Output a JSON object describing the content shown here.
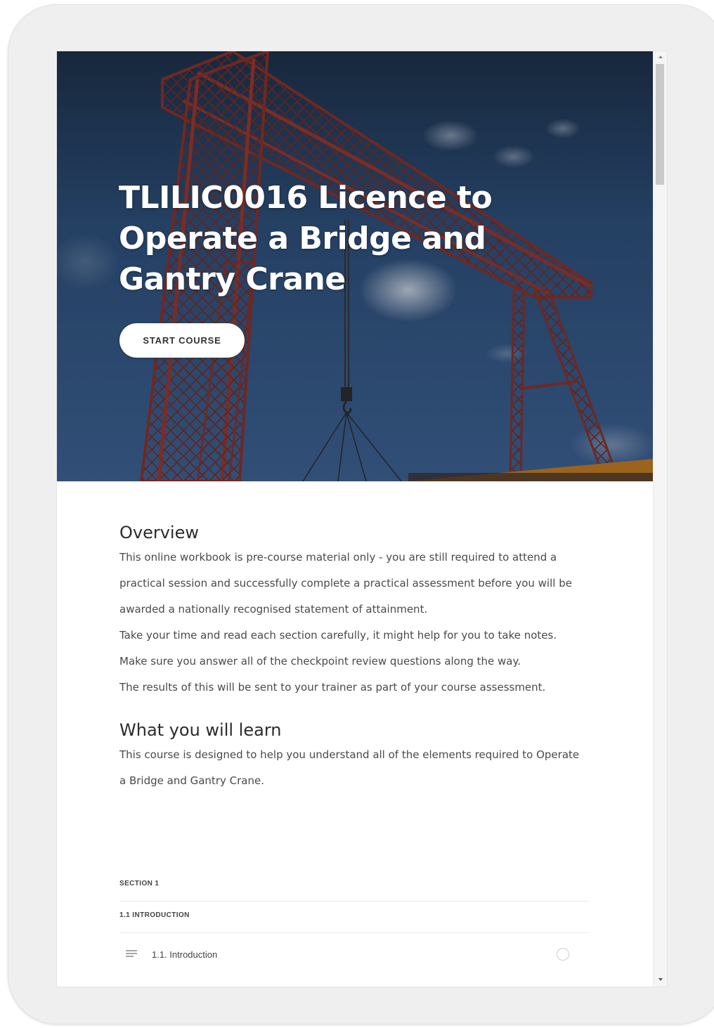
{
  "course": {
    "title": "TLILIC0016 Licence to Operate a Bridge and Gantry Crane",
    "start_button_label": "START COURSE"
  },
  "overview": {
    "heading": "Overview",
    "paragraphs": [
      "This online workbook is pre-course material only - you are still required to attend a practical session and successfully complete a practical assessment before you will be awarded a nationally recognised statement of attainment.",
      "Take your time and read each section carefully, it might help for you to take notes.",
      "Make sure you answer all of the checkpoint review questions along the way.",
      "The results of this will be sent to your trainer as part of your course assessment."
    ]
  },
  "learn": {
    "heading": "What you will learn",
    "paragraph": "This course is designed to help you understand all of the elements required to Operate a Bridge and Gantry Crane."
  },
  "outline": {
    "section_label": "SECTION 1",
    "subsection_label": "1.1 INTRODUCTION",
    "lessons": [
      {
        "label": "1.1. Introduction",
        "icon": "text-lines-icon",
        "status": "incomplete"
      }
    ]
  },
  "colors": {
    "hero_sky": "#2a4a70",
    "crane_red": "#8c2f22",
    "button_bg": "#ffffff",
    "text_dark": "#2b2b2b",
    "text_body": "#4a4a4a"
  }
}
